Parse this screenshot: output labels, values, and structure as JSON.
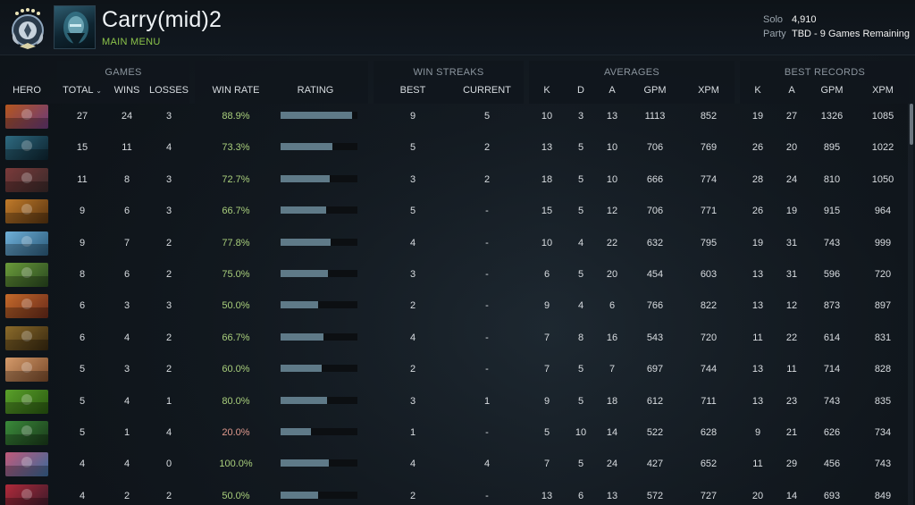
{
  "profile": {
    "name": "Carry(mid)2",
    "main_menu": "MAIN MENU",
    "solo_label": "Solo",
    "solo_value": "4,910",
    "party_label": "Party",
    "party_value": "TBD - 9 Games Remaining"
  },
  "groups": {
    "games": "GAMES",
    "win_streaks": "WIN STREAKS",
    "averages": "AVERAGES",
    "best_records": "BEST RECORDS"
  },
  "columns": {
    "hero": "HERO",
    "total": "TOTAL",
    "total_sort_icon": "chevron-down-icon",
    "wins": "WINS",
    "losses": "LOSSES",
    "win_rate": "WIN RATE",
    "rating": "RATING",
    "best": "BEST",
    "current": "CURRENT",
    "k": "K",
    "d": "D",
    "a": "A",
    "gpm": "GPM",
    "xpm": "XPM",
    "rk": "K",
    "ra": "A",
    "rgpm": "GPM",
    "rxpm": "XPM"
  },
  "colors": {
    "winrate_good": "#a9cf7c",
    "winrate_bad": "#e19a8e",
    "rating_bar": "#5f7a88",
    "main_menu": "#8bc34a"
  },
  "rows": [
    {
      "hero_icon": "hero-portrait-icon",
      "hero_color": [
        "#b5561e",
        "#6a3a7a"
      ],
      "total": "27",
      "wins": "24",
      "losses": "3",
      "win_rate": "88.9%",
      "rating": 0.93,
      "best": "9",
      "current": "5",
      "k": "10",
      "d": "3",
      "a": "13",
      "gpm": "1113",
      "xpm": "852",
      "rk": "19",
      "ra": "27",
      "rgpm": "1326",
      "rxpm": "1085"
    },
    {
      "hero_icon": "hero-portrait-icon",
      "hero_color": [
        "#2e6a80",
        "#0d2430"
      ],
      "total": "15",
      "wins": "11",
      "losses": "4",
      "win_rate": "73.3%",
      "rating": 0.68,
      "best": "5",
      "current": "2",
      "k": "13",
      "d": "5",
      "a": "10",
      "gpm": "706",
      "xpm": "769",
      "rk": "26",
      "ra": "20",
      "rgpm": "895",
      "rxpm": "1022"
    },
    {
      "hero_icon": "hero-portrait-icon",
      "hero_color": [
        "#7a3a3a",
        "#3a2a2a"
      ],
      "total": "11",
      "wins": "8",
      "losses": "3",
      "win_rate": "72.7%",
      "rating": 0.64,
      "best": "3",
      "current": "2",
      "k": "18",
      "d": "5",
      "a": "10",
      "gpm": "666",
      "xpm": "774",
      "rk": "28",
      "ra": "24",
      "rgpm": "810",
      "rxpm": "1050"
    },
    {
      "hero_icon": "hero-portrait-icon",
      "hero_color": [
        "#c07a2a",
        "#5a3510"
      ],
      "total": "9",
      "wins": "6",
      "losses": "3",
      "win_rate": "66.7%",
      "rating": 0.59,
      "best": "5",
      "current": "-",
      "k": "15",
      "d": "5",
      "a": "12",
      "gpm": "706",
      "xpm": "771",
      "rk": "26",
      "ra": "19",
      "rgpm": "915",
      "rxpm": "964"
    },
    {
      "hero_icon": "hero-portrait-icon",
      "hero_color": [
        "#6fb0d8",
        "#2b5a7a"
      ],
      "total": "9",
      "wins": "7",
      "losses": "2",
      "win_rate": "77.8%",
      "rating": 0.65,
      "best": "4",
      "current": "-",
      "k": "10",
      "d": "4",
      "a": "22",
      "gpm": "632",
      "xpm": "795",
      "rk": "19",
      "ra": "31",
      "rgpm": "743",
      "rxpm": "999"
    },
    {
      "hero_icon": "hero-portrait-icon",
      "hero_color": [
        "#6a9a3a",
        "#2a4a20"
      ],
      "total": "8",
      "wins": "6",
      "losses": "2",
      "win_rate": "75.0%",
      "rating": 0.62,
      "best": "3",
      "current": "-",
      "k": "6",
      "d": "5",
      "a": "20",
      "gpm": "454",
      "xpm": "603",
      "rk": "13",
      "ra": "31",
      "rgpm": "596",
      "rxpm": "720"
    },
    {
      "hero_icon": "hero-portrait-icon",
      "hero_color": [
        "#c46a2a",
        "#6a2a1a"
      ],
      "total": "6",
      "wins": "3",
      "losses": "3",
      "win_rate": "50.0%",
      "rating": 0.49,
      "best": "2",
      "current": "-",
      "k": "9",
      "d": "4",
      "a": "6",
      "gpm": "766",
      "xpm": "822",
      "rk": "13",
      "ra": "12",
      "rgpm": "873",
      "rxpm": "897"
    },
    {
      "hero_icon": "hero-portrait-icon",
      "hero_color": [
        "#8a6a2a",
        "#3a2a10"
      ],
      "total": "6",
      "wins": "4",
      "losses": "2",
      "win_rate": "66.7%",
      "rating": 0.56,
      "best": "4",
      "current": "-",
      "k": "7",
      "d": "8",
      "a": "16",
      "gpm": "543",
      "xpm": "720",
      "rk": "11",
      "ra": "22",
      "rgpm": "614",
      "rxpm": "831"
    },
    {
      "hero_icon": "hero-portrait-icon",
      "hero_color": [
        "#d49a6a",
        "#7a4a2a"
      ],
      "total": "5",
      "wins": "3",
      "losses": "2",
      "win_rate": "60.0%",
      "rating": 0.53,
      "best": "2",
      "current": "-",
      "k": "7",
      "d": "5",
      "a": "7",
      "gpm": "697",
      "xpm": "744",
      "rk": "13",
      "ra": "11",
      "rgpm": "714",
      "rxpm": "828"
    },
    {
      "hero_icon": "hero-portrait-icon",
      "hero_color": [
        "#5aa02a",
        "#2a5a10"
      ],
      "total": "5",
      "wins": "4",
      "losses": "1",
      "win_rate": "80.0%",
      "rating": 0.6,
      "best": "3",
      "current": "1",
      "k": "9",
      "d": "5",
      "a": "18",
      "gpm": "612",
      "xpm": "711",
      "rk": "13",
      "ra": "23",
      "rgpm": "743",
      "rxpm": "835"
    },
    {
      "hero_icon": "hero-portrait-icon",
      "hero_color": [
        "#3a8a3a",
        "#1a3a1a"
      ],
      "total": "5",
      "wins": "1",
      "losses": "4",
      "win_rate": "20.0%",
      "rating": 0.4,
      "best": "1",
      "current": "-",
      "k": "5",
      "d": "10",
      "a": "14",
      "gpm": "522",
      "xpm": "628",
      "rk": "9",
      "ra": "21",
      "rgpm": "626",
      "rxpm": "734"
    },
    {
      "hero_icon": "hero-portrait-icon",
      "hero_color": [
        "#c05a7a",
        "#3a6a9a"
      ],
      "total": "4",
      "wins": "4",
      "losses": "0",
      "win_rate": "100.0%",
      "rating": 0.63,
      "best": "4",
      "current": "4",
      "k": "7",
      "d": "5",
      "a": "24",
      "gpm": "427",
      "xpm": "652",
      "rk": "11",
      "ra": "29",
      "rgpm": "456",
      "rxpm": "743"
    },
    {
      "hero_icon": "hero-portrait-icon",
      "hero_color": [
        "#b02a3a",
        "#3a1a2a"
      ],
      "total": "4",
      "wins": "2",
      "losses": "2",
      "win_rate": "50.0%",
      "rating": 0.49,
      "best": "2",
      "current": "-",
      "k": "13",
      "d": "6",
      "a": "13",
      "gpm": "572",
      "xpm": "727",
      "rk": "20",
      "ra": "14",
      "rgpm": "693",
      "rxpm": "849"
    }
  ]
}
